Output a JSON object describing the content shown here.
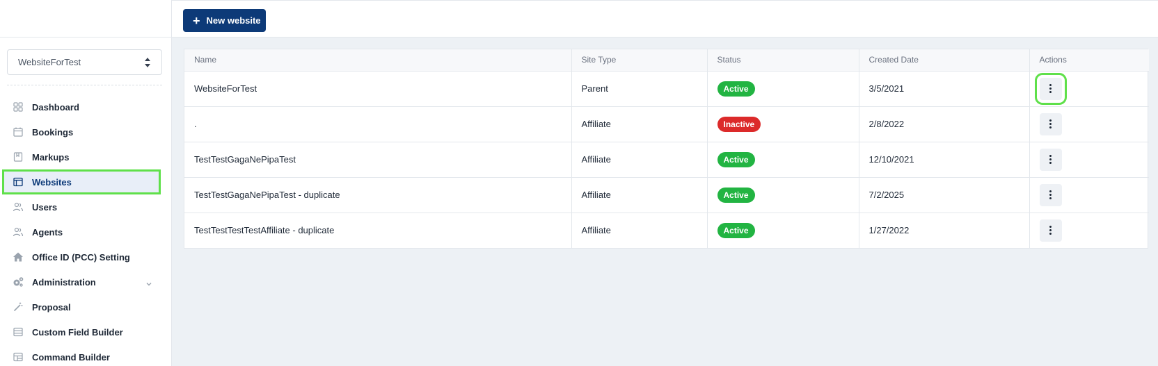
{
  "toolbar": {
    "new_website_label": "New website"
  },
  "site_selector": {
    "value": "WebsiteForTest"
  },
  "sidebar": {
    "items": [
      {
        "label": "Dashboard",
        "icon": "grid-icon"
      },
      {
        "label": "Bookings",
        "icon": "calendar-icon"
      },
      {
        "label": "Markups",
        "icon": "bookmark-icon"
      },
      {
        "label": "Websites",
        "icon": "browser-icon",
        "active": true
      },
      {
        "label": "Users",
        "icon": "users-icon"
      },
      {
        "label": "Agents",
        "icon": "agents-icon"
      },
      {
        "label": "Office ID (PCC) Setting",
        "icon": "home-icon"
      },
      {
        "label": "Administration",
        "icon": "gears-icon"
      },
      {
        "label": "Proposal",
        "icon": "wand-icon"
      },
      {
        "label": "Custom Field Builder",
        "icon": "list-icon"
      },
      {
        "label": "Command Builder",
        "icon": "table-icon"
      }
    ]
  },
  "table": {
    "headers": [
      "Name",
      "Site Type",
      "Status",
      "Created Date",
      "Actions"
    ],
    "rows": [
      {
        "name": "WebsiteForTest",
        "site_type": "Parent",
        "status": "Active",
        "created": "3/5/2021"
      },
      {
        "name": ".",
        "site_type": "Affiliate",
        "status": "Inactive",
        "created": "2/8/2022"
      },
      {
        "name": "TestTestGagaNePipaTest",
        "site_type": "Affiliate",
        "status": "Active",
        "created": "12/10/2021"
      },
      {
        "name": "TestTestGagaNePipaTest - duplicate",
        "site_type": "Affiliate",
        "status": "Active",
        "created": "7/2/2025"
      },
      {
        "name": "TestTestTestTestAffiliate - duplicate",
        "site_type": "Affiliate",
        "status": "Active",
        "created": "1/27/2022"
      }
    ]
  },
  "colors": {
    "brand": "#0d3a78",
    "active": "#22b442",
    "inactive": "#dc2a2a",
    "highlight": "#5fe04a"
  }
}
